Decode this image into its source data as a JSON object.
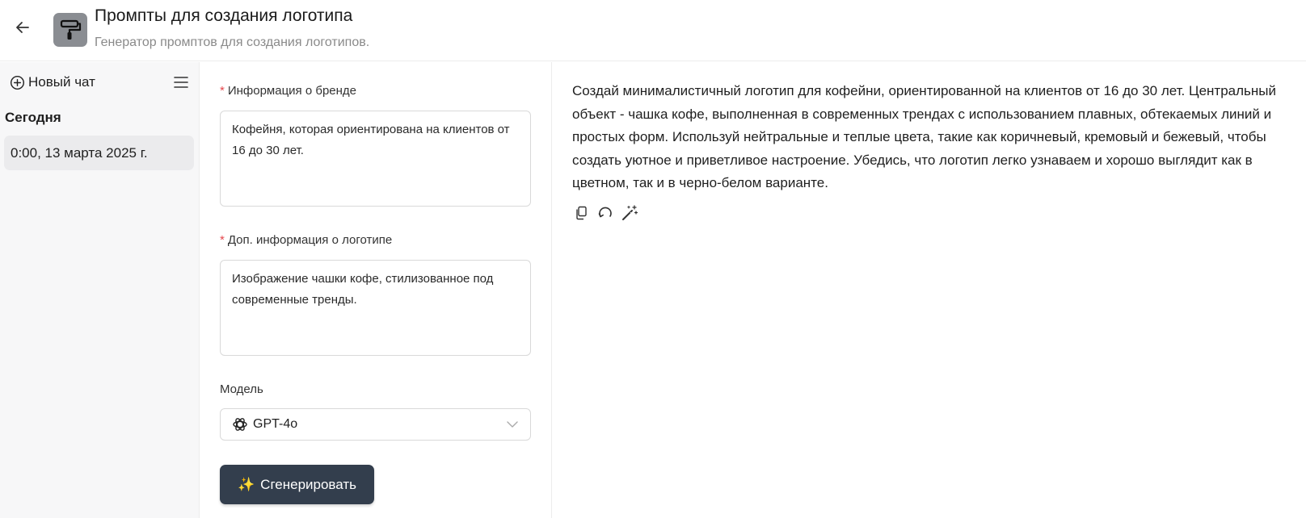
{
  "header": {
    "title": "Промпты для создания логотипа",
    "subtitle": "Генератор промптов для создания логотипов.",
    "back_icon": "arrow-left-icon",
    "app_icon": "paint-roller-icon"
  },
  "sidebar": {
    "new_chat_label": "Новый чат",
    "section_today": "Сегодня",
    "chats": [
      {
        "label": "0:00, 13 марта 2025 г."
      }
    ]
  },
  "form": {
    "brand_info": {
      "label": "Информация о бренде",
      "value": "Кофейня, которая ориентирована на клиентов от 16 до 30 лет."
    },
    "logo_info": {
      "label": "Доп. информация о логотипе",
      "value": "Изображение чашки кофе, стилизованное под современные тренды."
    },
    "model": {
      "label": "Модель",
      "selected": "GPT-4o"
    },
    "generate_label": "Сгенерировать",
    "generate_emoji": "✨"
  },
  "result": {
    "text": "Создай минималистичный логотип для кофейни, ориентированной на клиентов от 16 до 30 лет. Центральный объект - чашка кофе, выполненная в современных трендах с использованием плавных, обтекаемых линий и простых форм. Используй нейтральные и теплые цвета, такие как коричневый, кремовый и бежевый, чтобы создать уютное и приветливое настроение. Убедись, что логотип легко узнаваем и хорошо выглядит как в цветном, так и в черно-белом варианте."
  },
  "colors": {
    "button_bg": "#333e4d",
    "required": "#e5484d",
    "app_icon_bg": "#8a8d92"
  }
}
